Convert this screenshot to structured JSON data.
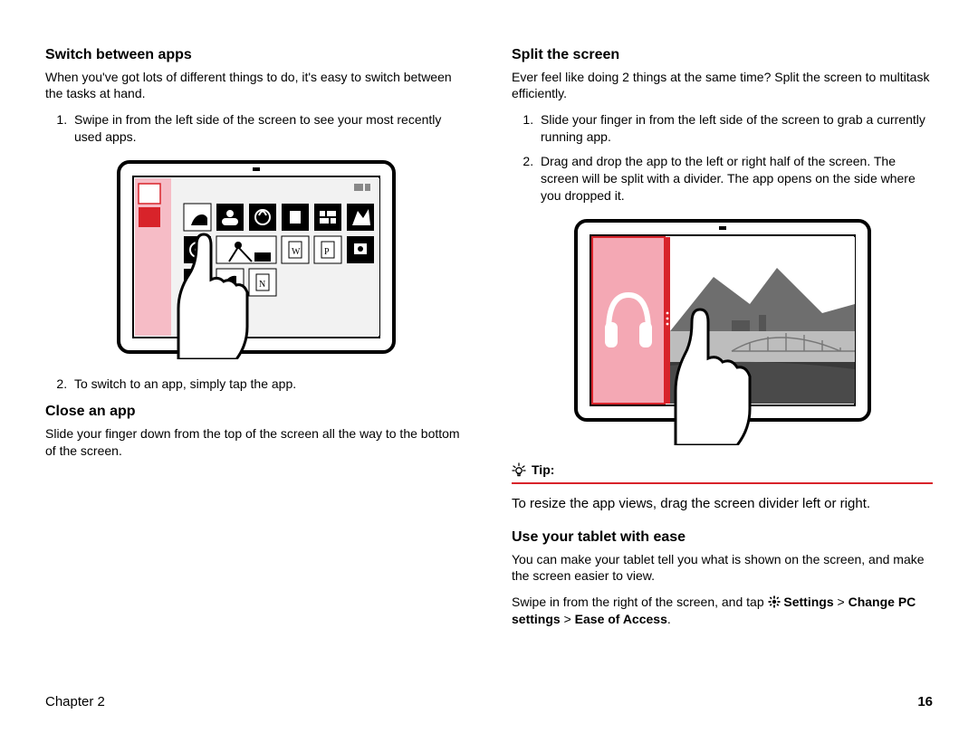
{
  "left": {
    "h1": "Switch between apps",
    "p1": "When you've got lots of different things to do, it's easy to switch between the tasks at hand.",
    "li1": "Swipe in from the left side of the screen to see your most recently used apps.",
    "li2": "To switch to an app, simply tap the app.",
    "h2": "Close an app",
    "p2": "Slide your finger down from the top of the screen all the way to the bottom of the screen."
  },
  "right": {
    "h1": "Split the screen",
    "p1": "Ever feel like doing 2 things at the same time? Split the screen to multitask efficiently.",
    "li1": "Slide your finger in from the left side of the screen to grab a currently running app.",
    "li2": "Drag and drop the app to the left or right half of the screen. The screen will be split with a divider. The app opens on the side where you dropped it.",
    "tip_label": "Tip:",
    "tip_body": "To resize the app views, drag the screen divider left or right.",
    "h2": "Use your tablet with ease",
    "p2": "You can make your tablet tell you what is shown on the screen, and make the screen easier to view.",
    "p3_a": "Swipe in from the right of the screen, and tap ",
    "p3_b": "Settings",
    "p3_c": " > ",
    "p3_d": "Change PC settings",
    "p3_e": " > ",
    "p3_f": "Ease of Access",
    "p3_g": "."
  },
  "footer": {
    "chapter": "Chapter 2",
    "page": "16"
  }
}
